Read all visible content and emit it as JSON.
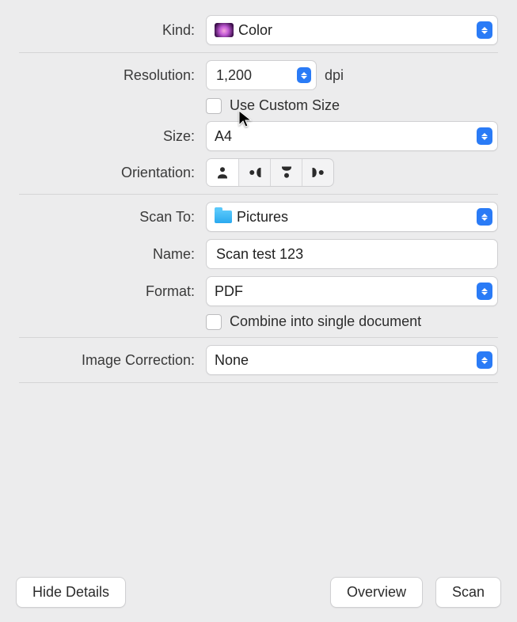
{
  "kind": {
    "label": "Kind:",
    "value": "Color"
  },
  "resolution": {
    "label": "Resolution:",
    "value": "1,200",
    "unit": "dpi",
    "custom_label": "Use Custom Size",
    "custom_checked": false
  },
  "size": {
    "label": "Size:",
    "value": "A4"
  },
  "orientation": {
    "label": "Orientation:",
    "selected": 0
  },
  "scan_to": {
    "label": "Scan To:",
    "value": "Pictures"
  },
  "name": {
    "label": "Name:",
    "value": "Scan test 123"
  },
  "format": {
    "label": "Format:",
    "value": "PDF",
    "combine_label": "Combine into single document",
    "combine_checked": false
  },
  "image_correction": {
    "label": "Image Correction:",
    "value": "None"
  },
  "buttons": {
    "hide_details": "Hide Details",
    "overview": "Overview",
    "scan": "Scan"
  }
}
